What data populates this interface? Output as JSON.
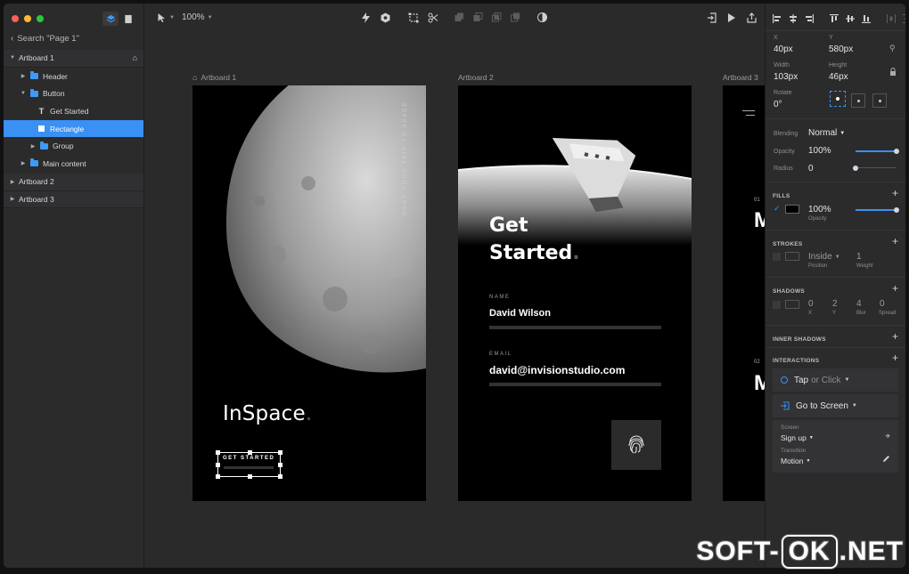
{
  "sidebar": {
    "back_label": "Search \"Page 1\"",
    "layers": [
      {
        "label": "Artboard 1"
      },
      {
        "label": "Header"
      },
      {
        "label": "Button"
      },
      {
        "label": "Get Started"
      },
      {
        "label": "Rectangle"
      },
      {
        "label": "Group"
      },
      {
        "label": "Main content"
      },
      {
        "label": "Artboard 2"
      },
      {
        "label": "Artboard 3"
      }
    ]
  },
  "toolbar": {
    "zoom": "100%"
  },
  "artboards": [
    {
      "label": "Artboard 1"
    },
    {
      "label": "Artboard 2"
    },
    {
      "label": "Artboard 3"
    }
  ],
  "artboard1": {
    "vertical_text": "BOOK YOUR TRIP TO SPACE",
    "brand": "InSpace",
    "brand_dot": ".",
    "button_label": "GET STARTED"
  },
  "artboard2": {
    "heading_line1": "Get",
    "heading_line2": "Started",
    "heading_dot": ".",
    "name_label": "NAME",
    "name_value": "David Wilson",
    "email_label": "EMAIL",
    "email_value": "david@invisionstudio.com"
  },
  "artboard3": {
    "num1": "01",
    "num2": "02",
    "letter": "M"
  },
  "inspector": {
    "x_label": "X",
    "x_value": "40px",
    "y_label": "Y",
    "y_value": "580px",
    "w_label": "Width",
    "w_value": "103px",
    "h_label": "Height",
    "h_value": "46px",
    "rotate_label": "Rotate",
    "rotate_value": "0°",
    "blending_label": "Blending",
    "blending_value": "Normal",
    "opacity_label": "Opacity",
    "opacity_value": "100%",
    "opacity_fraction": 1.0,
    "radius_label": "Radius",
    "radius_value": "0",
    "radius_fraction": 0.0,
    "fills_title": "FILLS",
    "fill_opacity_value": "100%",
    "fill_opacity_label": "Opacity",
    "fill_color": "#000000",
    "strokes_title": "STROKES",
    "stroke_position_value": "Inside",
    "stroke_position_label": "Position",
    "stroke_weight_value": "1",
    "stroke_weight_label": "Weight",
    "shadows_title": "SHADOWS",
    "shadow_x": "0",
    "shadow_x_label": "X",
    "shadow_y": "2",
    "shadow_y_label": "Y",
    "shadow_blur": "4",
    "shadow_blur_label": "Blur",
    "shadow_spread": "0",
    "shadow_spread_label": "Spread",
    "inner_shadows_title": "INNER SHADOWS",
    "interactions_title": "INTERACTIONS",
    "trigger_main": "Tap",
    "trigger_alt": "or Click",
    "action": "Go to Screen",
    "screen_label": "Screen",
    "screen_value": "Sign up",
    "transition_label": "Transition",
    "transition_value": "Motion"
  },
  "watermark": {
    "part1": "SOFT-",
    "part2": "OK",
    "part3": ".NET"
  },
  "colors": {
    "accent": "#3a90f3",
    "folder": "#3d9bf5"
  }
}
